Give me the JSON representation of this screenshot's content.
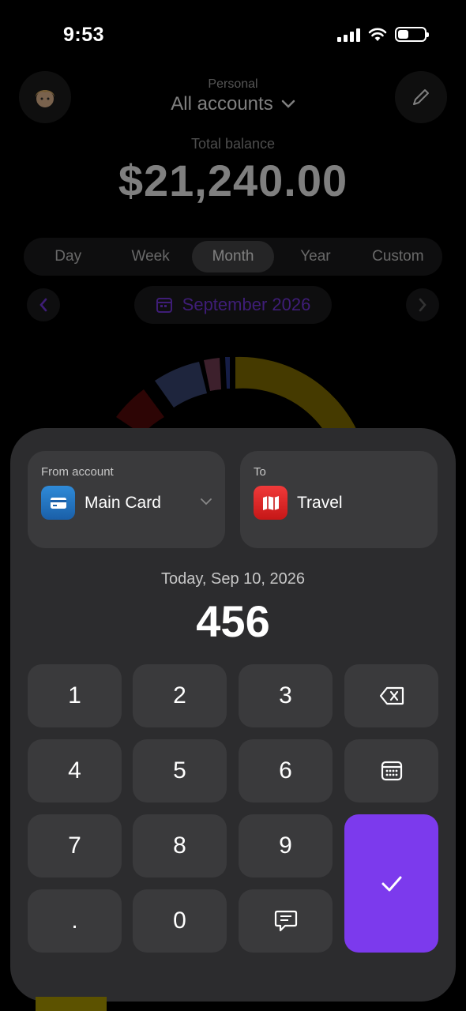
{
  "status_bar": {
    "time": "9:53"
  },
  "header": {
    "account_group": "Personal",
    "account_selector": "All accounts",
    "balance_label": "Total balance",
    "balance_value": "$21,240.00"
  },
  "period_tabs": [
    {
      "label": "Day",
      "active": false
    },
    {
      "label": "Week",
      "active": false
    },
    {
      "label": "Month",
      "active": true
    },
    {
      "label": "Year",
      "active": false
    },
    {
      "label": "Custom",
      "active": false
    }
  ],
  "date_range": {
    "label": "September 2026"
  },
  "donut_segment_colors": [
    "#8b7400",
    "#5a0a0a",
    "#3d4a7a",
    "#7a4058",
    "#2a3a8c"
  ],
  "transfer": {
    "from_label": "From account",
    "from_name": "Main Card",
    "to_label": "To",
    "to_name": "Travel",
    "date": "Today, Sep 10, 2026",
    "amount": "456"
  },
  "keypad": {
    "k1": "1",
    "k2": "2",
    "k3": "3",
    "k4": "4",
    "k5": "5",
    "k6": "6",
    "k7": "7",
    "k8": "8",
    "k9": "9",
    "dot": ".",
    "k0": "0"
  },
  "colors": {
    "accent": "#7c3aed",
    "sheet_bg": "#2c2c2e",
    "key_bg": "#3a3a3c"
  }
}
